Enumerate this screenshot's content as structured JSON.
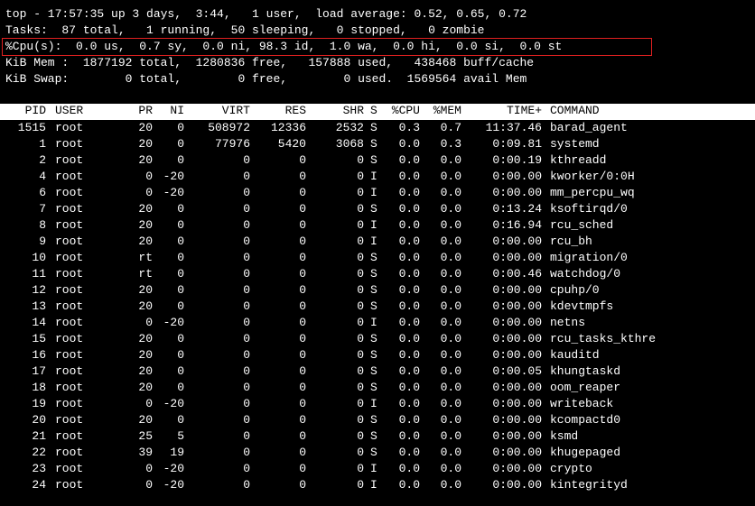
{
  "summary": {
    "uptime_line": "top - 17:57:35 up 3 days,  3:44,   1 user,  load average: 0.52, 0.65, 0.72",
    "tasks_line": "Tasks:  87 total,   1 running,  50 sleeping,   0 stopped,   0 zombie",
    "cpu_line": "%Cpu(s):  0.0 us,  0.7 sy,  0.0 ni, 98.3 id,  1.0 wa,  0.0 hi,  0.0 si,  0.0 st",
    "mem_line": "KiB Mem :  1877192 total,  1280836 free,   157888 used,   438468 buff/cache",
    "swap_line": "KiB Swap:        0 total,        0 free,        0 used.  1569564 avail Mem"
  },
  "table": {
    "headers": {
      "pid": "PID",
      "user": "USER",
      "pr": "PR",
      "ni": "NI",
      "virt": "VIRT",
      "res": "RES",
      "shr": "SHR",
      "s": "S",
      "cpu": "%CPU",
      "mem": "%MEM",
      "time": "TIME+",
      "command": "COMMAND"
    },
    "rows": [
      {
        "pid": "1515",
        "user": "root",
        "pr": "20",
        "ni": "0",
        "virt": "508972",
        "res": "12336",
        "shr": "2532",
        "s": "S",
        "cpu": "0.3",
        "mem": "0.7",
        "time": "11:37.46",
        "command": "barad_agent"
      },
      {
        "pid": "1",
        "user": "root",
        "pr": "20",
        "ni": "0",
        "virt": "77976",
        "res": "5420",
        "shr": "3068",
        "s": "S",
        "cpu": "0.0",
        "mem": "0.3",
        "time": "0:09.81",
        "command": "systemd"
      },
      {
        "pid": "2",
        "user": "root",
        "pr": "20",
        "ni": "0",
        "virt": "0",
        "res": "0",
        "shr": "0",
        "s": "S",
        "cpu": "0.0",
        "mem": "0.0",
        "time": "0:00.19",
        "command": "kthreadd"
      },
      {
        "pid": "4",
        "user": "root",
        "pr": "0",
        "ni": "-20",
        "virt": "0",
        "res": "0",
        "shr": "0",
        "s": "I",
        "cpu": "0.0",
        "mem": "0.0",
        "time": "0:00.00",
        "command": "kworker/0:0H"
      },
      {
        "pid": "6",
        "user": "root",
        "pr": "0",
        "ni": "-20",
        "virt": "0",
        "res": "0",
        "shr": "0",
        "s": "I",
        "cpu": "0.0",
        "mem": "0.0",
        "time": "0:00.00",
        "command": "mm_percpu_wq"
      },
      {
        "pid": "7",
        "user": "root",
        "pr": "20",
        "ni": "0",
        "virt": "0",
        "res": "0",
        "shr": "0",
        "s": "S",
        "cpu": "0.0",
        "mem": "0.0",
        "time": "0:13.24",
        "command": "ksoftirqd/0"
      },
      {
        "pid": "8",
        "user": "root",
        "pr": "20",
        "ni": "0",
        "virt": "0",
        "res": "0",
        "shr": "0",
        "s": "I",
        "cpu": "0.0",
        "mem": "0.0",
        "time": "0:16.94",
        "command": "rcu_sched"
      },
      {
        "pid": "9",
        "user": "root",
        "pr": "20",
        "ni": "0",
        "virt": "0",
        "res": "0",
        "shr": "0",
        "s": "I",
        "cpu": "0.0",
        "mem": "0.0",
        "time": "0:00.00",
        "command": "rcu_bh"
      },
      {
        "pid": "10",
        "user": "root",
        "pr": "rt",
        "ni": "0",
        "virt": "0",
        "res": "0",
        "shr": "0",
        "s": "S",
        "cpu": "0.0",
        "mem": "0.0",
        "time": "0:00.00",
        "command": "migration/0"
      },
      {
        "pid": "11",
        "user": "root",
        "pr": "rt",
        "ni": "0",
        "virt": "0",
        "res": "0",
        "shr": "0",
        "s": "S",
        "cpu": "0.0",
        "mem": "0.0",
        "time": "0:00.46",
        "command": "watchdog/0"
      },
      {
        "pid": "12",
        "user": "root",
        "pr": "20",
        "ni": "0",
        "virt": "0",
        "res": "0",
        "shr": "0",
        "s": "S",
        "cpu": "0.0",
        "mem": "0.0",
        "time": "0:00.00",
        "command": "cpuhp/0"
      },
      {
        "pid": "13",
        "user": "root",
        "pr": "20",
        "ni": "0",
        "virt": "0",
        "res": "0",
        "shr": "0",
        "s": "S",
        "cpu": "0.0",
        "mem": "0.0",
        "time": "0:00.00",
        "command": "kdevtmpfs"
      },
      {
        "pid": "14",
        "user": "root",
        "pr": "0",
        "ni": "-20",
        "virt": "0",
        "res": "0",
        "shr": "0",
        "s": "I",
        "cpu": "0.0",
        "mem": "0.0",
        "time": "0:00.00",
        "command": "netns"
      },
      {
        "pid": "15",
        "user": "root",
        "pr": "20",
        "ni": "0",
        "virt": "0",
        "res": "0",
        "shr": "0",
        "s": "S",
        "cpu": "0.0",
        "mem": "0.0",
        "time": "0:00.00",
        "command": "rcu_tasks_kthre"
      },
      {
        "pid": "16",
        "user": "root",
        "pr": "20",
        "ni": "0",
        "virt": "0",
        "res": "0",
        "shr": "0",
        "s": "S",
        "cpu": "0.0",
        "mem": "0.0",
        "time": "0:00.00",
        "command": "kauditd"
      },
      {
        "pid": "17",
        "user": "root",
        "pr": "20",
        "ni": "0",
        "virt": "0",
        "res": "0",
        "shr": "0",
        "s": "S",
        "cpu": "0.0",
        "mem": "0.0",
        "time": "0:00.05",
        "command": "khungtaskd"
      },
      {
        "pid": "18",
        "user": "root",
        "pr": "20",
        "ni": "0",
        "virt": "0",
        "res": "0",
        "shr": "0",
        "s": "S",
        "cpu": "0.0",
        "mem": "0.0",
        "time": "0:00.00",
        "command": "oom_reaper"
      },
      {
        "pid": "19",
        "user": "root",
        "pr": "0",
        "ni": "-20",
        "virt": "0",
        "res": "0",
        "shr": "0",
        "s": "I",
        "cpu": "0.0",
        "mem": "0.0",
        "time": "0:00.00",
        "command": "writeback"
      },
      {
        "pid": "20",
        "user": "root",
        "pr": "20",
        "ni": "0",
        "virt": "0",
        "res": "0",
        "shr": "0",
        "s": "S",
        "cpu": "0.0",
        "mem": "0.0",
        "time": "0:00.00",
        "command": "kcompactd0"
      },
      {
        "pid": "21",
        "user": "root",
        "pr": "25",
        "ni": "5",
        "virt": "0",
        "res": "0",
        "shr": "0",
        "s": "S",
        "cpu": "0.0",
        "mem": "0.0",
        "time": "0:00.00",
        "command": "ksmd"
      },
      {
        "pid": "22",
        "user": "root",
        "pr": "39",
        "ni": "19",
        "virt": "0",
        "res": "0",
        "shr": "0",
        "s": "S",
        "cpu": "0.0",
        "mem": "0.0",
        "time": "0:00.00",
        "command": "khugepaged"
      },
      {
        "pid": "23",
        "user": "root",
        "pr": "0",
        "ni": "-20",
        "virt": "0",
        "res": "0",
        "shr": "0",
        "s": "I",
        "cpu": "0.0",
        "mem": "0.0",
        "time": "0:00.00",
        "command": "crypto"
      },
      {
        "pid": "24",
        "user": "root",
        "pr": "0",
        "ni": "-20",
        "virt": "0",
        "res": "0",
        "shr": "0",
        "s": "I",
        "cpu": "0.0",
        "mem": "0.0",
        "time": "0:00.00",
        "command": "kintegrityd"
      }
    ]
  },
  "colors": {
    "background": "#000000",
    "text": "#ffffff",
    "header_bar": "#ffffff",
    "header_text": "#000000",
    "highlight_box": "#e02020"
  }
}
